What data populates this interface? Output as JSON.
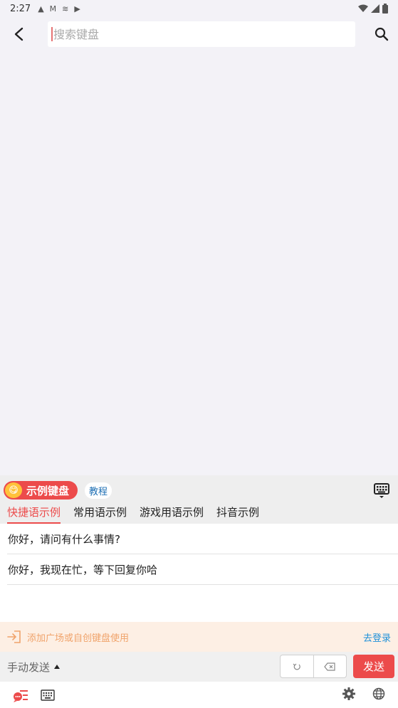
{
  "status": {
    "time": "2:27",
    "icons": [
      "a-icon",
      "gmail-icon",
      "cast-icon",
      "play-store-icon"
    ],
    "right_icons": [
      "wifi-icon",
      "signal-icon",
      "battery-icon"
    ]
  },
  "search": {
    "placeholder": "搜索键盘",
    "value": ""
  },
  "keyboard": {
    "name": "示例键盘",
    "tutorial": "教程"
  },
  "tabs": [
    {
      "label": "快捷语示例",
      "active": true
    },
    {
      "label": "常用语示例",
      "active": false
    },
    {
      "label": "游戏用语示例",
      "active": false
    },
    {
      "label": "抖音示例",
      "active": false
    }
  ],
  "phrases": [
    "你好，请问有什么事情?",
    "你好，我现在忙，等下回复你哈"
  ],
  "login_bar": {
    "text": "添加广场或自创键盘使用",
    "link": "去登录"
  },
  "send_bar": {
    "mode": "手动发送",
    "send": "发送"
  },
  "colors": {
    "accent": "#ec4b4b",
    "link": "#1e90d9",
    "login_text": "#f0a36b",
    "login_bg": "#fdefe4"
  }
}
